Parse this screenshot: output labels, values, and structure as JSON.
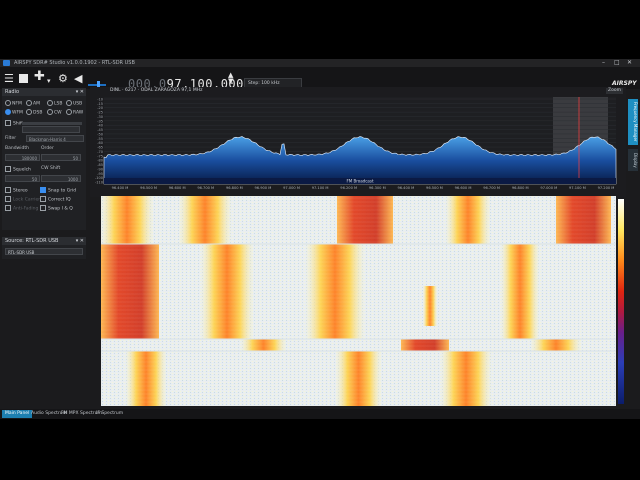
{
  "window": {
    "title": "AIRSPY SDR# Studio v1.0.0.1902 - RTL-SDR USB",
    "controls": [
      "–",
      "□",
      "✕"
    ]
  },
  "toolbar": {
    "frequency_dim": "000.0",
    "frequency_bright": "97.100.000",
    "step": "Step: 100 kHz",
    "brand": "AIRSPY"
  },
  "radio_panel": {
    "title": "Radio",
    "modes": [
      {
        "label": "NFM",
        "on": false
      },
      {
        "label": "AM",
        "on": false
      },
      {
        "label": "LSB",
        "on": false
      },
      {
        "label": "USB",
        "on": false
      },
      {
        "label": "WFM",
        "on": true
      },
      {
        "label": "DSB",
        "on": false
      },
      {
        "label": "CW",
        "on": false
      },
      {
        "label": "RAW",
        "on": false
      }
    ],
    "shift_label": "Shift",
    "filter_label": "Filter",
    "filter_value": "Blackman-Harris 4",
    "bandwidth_label": "Bandwidth",
    "order_label": "Order",
    "bandwidth_value": "180000",
    "order_value": "50",
    "squelch_label": "Squelch",
    "cw_shift_label": "CW Shift",
    "squelch_value": "50",
    "cw_value": "1000",
    "checks": [
      {
        "label": "Stereo",
        "on": false,
        "dis": false
      },
      {
        "label": "Snap to Grid",
        "on": true,
        "dis": false
      },
      {
        "label": "Lock Carrier",
        "on": false,
        "dis": true
      },
      {
        "label": "Correct IQ",
        "on": false,
        "dis": false
      },
      {
        "label": "Anti-Fading",
        "on": false,
        "dis": true
      },
      {
        "label": "Swap I & Q",
        "on": false,
        "dis": false
      }
    ]
  },
  "source_panel": {
    "title": "Source: RTL-SDR USB",
    "device": "RTL-SDR USB"
  },
  "spectrum": {
    "header": "DINL  · 6217 · ODAL ZARAGOZA 97,1 MHz",
    "zoom_label": "Zoom",
    "fm_label": "FM Broadcast",
    "db_ticks": [
      "-10",
      "-15",
      "-20",
      "-25",
      "-30",
      "-35",
      "-40",
      "-45",
      "-50",
      "-55",
      "-60",
      "-65",
      "-70",
      "-75",
      "-80",
      "-85",
      "-90",
      "-95",
      "-100",
      "-110"
    ],
    "freq_ticks": [
      "96.400 M",
      "96.500 M",
      "96.600 M",
      "96.700 M",
      "96.800 M",
      "96.900 M",
      "97.000 M",
      "97.100 M",
      "96.200 M",
      "96.300 M",
      "96.400 M",
      "96.500 M",
      "96.600 M",
      "96.700 M",
      "96.800 M",
      "97.000 M",
      "97.100 M",
      "97.200 M"
    ]
  },
  "right_tabs": [
    "Frequency Manager",
    "Display"
  ],
  "bottom_tabs": [
    {
      "label": "Main Panel",
      "active": true
    },
    {
      "label": "Audio Spectrum",
      "active": false
    },
    {
      "label": "FM MPX Spectrum",
      "active": false
    },
    {
      "label": "IF Spectrum",
      "active": false
    }
  ]
}
